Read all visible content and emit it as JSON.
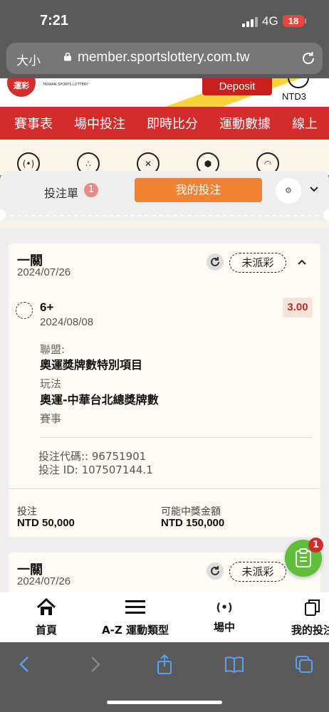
{
  "status_bar": {
    "time": "7:21",
    "network": "4G",
    "battery": "18"
  },
  "browser": {
    "text_size": "大小",
    "url": "member.sportslottery.com.tw"
  },
  "site_header": {
    "logo_text": "運彩",
    "logo_caption": "TAIWAN SPORTS LOTTERY",
    "deposit_label": "Deposit",
    "currency_badge": "NTD3"
  },
  "main_nav": {
    "items": [
      "賽事表",
      "場中投注",
      "即時比分",
      "運動數據",
      "線上"
    ]
  },
  "sports_icons": [
    "live-icon",
    "baseball-icon",
    "basketball-icon",
    "soccer-icon",
    "tennis-icon"
  ],
  "betslip": {
    "slip_tab_label": "投注單",
    "slip_count": "1",
    "my_bets_label": "我的投注"
  },
  "bets": [
    {
      "type": "一關",
      "date": "2024/07/26",
      "status": "未派彩",
      "selection": "6+",
      "selection_date": "2024/08/08",
      "odds": "3.00",
      "league_label": "聯盟:",
      "league": "奧運獎牌數特別項目",
      "market_label": "玩法",
      "market": "奧運-中華台北總獎牌數",
      "event_label": "賽事",
      "bet_code": "投注代碼:: 96751901",
      "bet_id": "投注 ID: 107507144.1",
      "stake_label": "投注",
      "stake": "NTD 50,000",
      "payout_label": "可能中獎金額",
      "payout": "NTD 150,000"
    },
    {
      "type": "一關",
      "date": "2024/07/26",
      "status": "未派彩"
    }
  ],
  "fab": {
    "badge": "1"
  },
  "bottom_nav": {
    "items": [
      {
        "label": "首頁",
        "icon": "home-icon"
      },
      {
        "label": "A-Z 運動類型",
        "icon": "menu-icon"
      },
      {
        "label": "場中",
        "icon": "live-icon"
      },
      {
        "label": "我的投注",
        "icon": "copy-icon"
      }
    ]
  },
  "colors": {
    "brand_red": "#d42b2b",
    "accent_orange": "#f08230",
    "fab_green": "#5fbf3a"
  }
}
